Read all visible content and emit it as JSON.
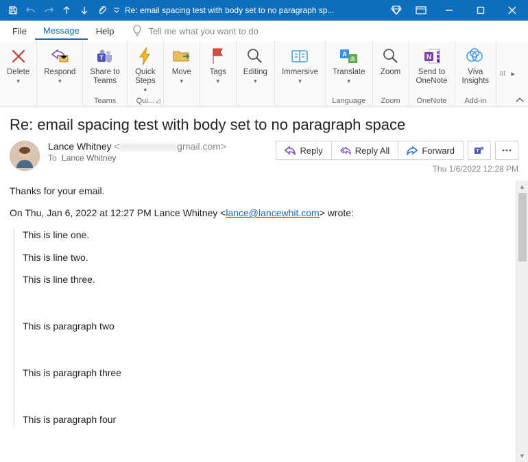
{
  "window": {
    "title": "Re: email spacing test with body set to no paragraph sp..."
  },
  "menu": {
    "file": "File",
    "message": "Message",
    "help": "Help",
    "tellme": "Tell me what you want to do"
  },
  "ribbon": {
    "delete": "Delete",
    "respond": "Respond",
    "share_teams": "Share to\nTeams",
    "teams_group": "Teams",
    "quick_steps": "Quick\nSteps",
    "quick_group": "Qui...",
    "move": "Move",
    "tags": "Tags",
    "editing": "Editing",
    "immersive": "Immersive",
    "translate": "Translate",
    "language_group": "Language",
    "zoom": "Zoom",
    "zoom_group": "Zoom",
    "send_onenote": "Send to\nOneNote",
    "onenote_group": "OneNote",
    "viva": "Viva\nInsights",
    "addin_group": "Add-in",
    "at": "at"
  },
  "email": {
    "subject": "Re: email spacing test with body set to no paragraph space",
    "from_name": "Lance Whitney",
    "from_email_blur": "xxxxxxxxxxxx",
    "from_domain": "gmail.com>",
    "to_label": "To",
    "to_name": "Lance Whitney",
    "timestamp": "Thu 1/6/2022 12:28 PM",
    "reply": "Reply",
    "reply_all": "Reply All",
    "forward": "Forward"
  },
  "body": {
    "thanks": "Thanks for your email.",
    "quote_header_pre": "On Thu, Jan 6, 2022 at 12:27 PM Lance Whitney <",
    "quote_header_link": "lance@lancewhit.com",
    "quote_header_post": "> wrote:",
    "l1": "This is line one.",
    "l2": "This is line two.",
    "l3": "This is line three.",
    "p2": "This is paragraph two",
    "p3": "This is paragraph three",
    "p4": "This is paragraph four"
  }
}
